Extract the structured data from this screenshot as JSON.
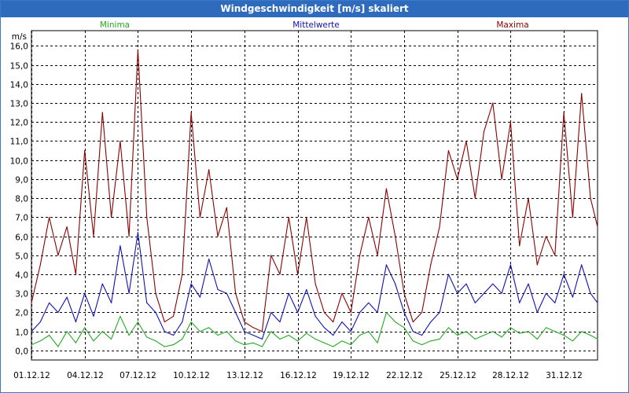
{
  "window": {
    "title": "Windgeschwindigkeit [m/s] skaliert"
  },
  "colors": {
    "minima": "#22aa22",
    "mittel": "#1010b4",
    "maxima": "#8b0000",
    "grid": "#000000",
    "titlebar": "#2f6bbd"
  },
  "chart_data": {
    "type": "line",
    "title": "Windgeschwindigkeit [m/s] skaliert",
    "ylabel": "m/s",
    "xlabel": "",
    "ylim": [
      -0.5,
      16.8
    ],
    "yticks": [
      "0,0",
      "1,0",
      "2,0",
      "3,0",
      "4,0",
      "5,0",
      "6,0",
      "7,0",
      "8,0",
      "9,0",
      "10,0",
      "11,0",
      "12,0",
      "13,0",
      "14,0",
      "15,0",
      "16,0"
    ],
    "xlim": [
      1,
      32.9
    ],
    "xticks": [
      {
        "day": 1,
        "label": "01.12.12"
      },
      {
        "day": 4,
        "label": "04.12.12"
      },
      {
        "day": 7,
        "label": "07.12.12"
      },
      {
        "day": 10,
        "label": "10.12.12"
      },
      {
        "day": 13,
        "label": "13.12.12"
      },
      {
        "day": 16,
        "label": "16.12.12"
      },
      {
        "day": 19,
        "label": "19.12.12"
      },
      {
        "day": 22,
        "label": "22.12.12"
      },
      {
        "day": 25,
        "label": "25.12.12"
      },
      {
        "day": 28,
        "label": "28.12.12"
      },
      {
        "day": 31,
        "label": "31.12.12"
      }
    ],
    "grid": true,
    "legend_position": "top",
    "series": [
      {
        "name": "Minima",
        "color": "#22aa22",
        "x": [
          1,
          1.5,
          2,
          2.5,
          3,
          3.5,
          4,
          4.5,
          5,
          5.5,
          6,
          6.5,
          7,
          7.5,
          8,
          8.5,
          9,
          9.5,
          10,
          10.5,
          11,
          11.5,
          12,
          12.5,
          13,
          13.5,
          14,
          14.5,
          15,
          15.5,
          16,
          16.5,
          17,
          17.5,
          18,
          18.5,
          19,
          19.5,
          20,
          20.5,
          21,
          21.5,
          22,
          22.5,
          23,
          23.5,
          24,
          24.5,
          25,
          25.5,
          26,
          26.5,
          27,
          27.5,
          28,
          28.5,
          29,
          29.5,
          30,
          30.5,
          31,
          31.5,
          32,
          32.5,
          32.9
        ],
        "values": [
          0.3,
          0.5,
          0.8,
          0.2,
          1.0,
          0.4,
          1.2,
          0.5,
          1.0,
          0.6,
          1.8,
          0.8,
          1.5,
          0.7,
          0.5,
          0.2,
          0.3,
          0.6,
          1.5,
          1.0,
          1.2,
          0.8,
          1.0,
          0.5,
          0.3,
          0.4,
          0.2,
          1.0,
          0.6,
          0.8,
          0.5,
          0.9,
          0.6,
          0.4,
          0.2,
          0.5,
          0.3,
          0.8,
          1.0,
          0.4,
          2.0,
          1.5,
          1.2,
          0.5,
          0.3,
          0.5,
          0.6,
          1.2,
          0.8,
          1.0,
          0.6,
          0.8,
          1.0,
          0.7,
          1.2,
          0.9,
          1.0,
          0.6,
          1.2,
          1.0,
          0.8,
          0.5,
          1.0,
          0.8,
          0.6
        ]
      },
      {
        "name": "Mittelwerte",
        "color": "#1010b4",
        "x": [
          1,
          1.5,
          2,
          2.5,
          3,
          3.5,
          4,
          4.5,
          5,
          5.5,
          6,
          6.5,
          7,
          7.5,
          8,
          8.5,
          9,
          9.5,
          10,
          10.5,
          11,
          11.5,
          12,
          12.5,
          13,
          13.5,
          14,
          14.5,
          15,
          15.5,
          16,
          16.5,
          17,
          17.5,
          18,
          18.5,
          19,
          19.5,
          20,
          20.5,
          21,
          21.5,
          22,
          22.5,
          23,
          23.5,
          24,
          24.5,
          25,
          25.5,
          26,
          26.5,
          27,
          27.5,
          28,
          28.5,
          29,
          29.5,
          30,
          30.5,
          31,
          31.5,
          32,
          32.5,
          32.9
        ],
        "values": [
          1.0,
          1.5,
          2.5,
          2.0,
          2.8,
          1.5,
          3.0,
          1.8,
          3.5,
          2.5,
          5.5,
          3.0,
          6.2,
          2.5,
          2.0,
          1.0,
          0.8,
          1.5,
          3.5,
          2.8,
          4.8,
          3.2,
          3.0,
          2.0,
          1.0,
          0.8,
          0.6,
          2.0,
          1.5,
          3.0,
          2.0,
          3.2,
          1.8,
          1.2,
          0.8,
          1.5,
          1.0,
          2.0,
          2.5,
          2.0,
          4.5,
          3.5,
          2.0,
          1.0,
          0.8,
          1.5,
          2.0,
          4.0,
          3.0,
          3.5,
          2.5,
          3.0,
          3.5,
          3.0,
          4.5,
          2.5,
          3.5,
          2.0,
          3.0,
          2.5,
          4.0,
          2.8,
          4.5,
          3.0,
          2.5
        ]
      },
      {
        "name": "Maxima",
        "color": "#8b0000",
        "x": [
          1,
          1.5,
          2,
          2.5,
          3,
          3.5,
          4,
          4.5,
          5,
          5.5,
          6,
          6.5,
          7,
          7.5,
          8,
          8.5,
          9,
          9.5,
          10,
          10.5,
          11,
          11.5,
          12,
          12.5,
          13,
          13.5,
          14,
          14.5,
          15,
          15.5,
          16,
          16.5,
          17,
          17.5,
          18,
          18.5,
          19,
          19.5,
          20,
          20.5,
          21,
          21.5,
          22,
          22.5,
          23,
          23.5,
          24,
          24.5,
          25,
          25.5,
          26,
          26.5,
          27,
          27.5,
          28,
          28.5,
          29,
          29.5,
          30,
          30.5,
          31,
          31.5,
          32,
          32.5,
          32.9
        ],
        "values": [
          2.5,
          4.5,
          7.0,
          5.0,
          6.5,
          4.0,
          10.5,
          6.0,
          12.5,
          7.0,
          11.0,
          6.0,
          15.8,
          7.0,
          3.0,
          1.5,
          1.8,
          4.0,
          12.5,
          7.0,
          9.5,
          6.0,
          7.5,
          3.0,
          1.5,
          1.2,
          1.0,
          5.0,
          4.0,
          7.0,
          4.0,
          7.0,
          3.5,
          2.0,
          1.5,
          3.0,
          2.0,
          5.0,
          7.0,
          5.0,
          8.5,
          6.0,
          3.0,
          1.5,
          2.0,
          4.5,
          6.5,
          10.5,
          9.0,
          11.0,
          8.0,
          11.5,
          13.0,
          9.0,
          12.0,
          5.5,
          8.0,
          4.5,
          6.0,
          5.0,
          12.5,
          7.0,
          13.5,
          8.0,
          6.5
        ]
      }
    ]
  }
}
